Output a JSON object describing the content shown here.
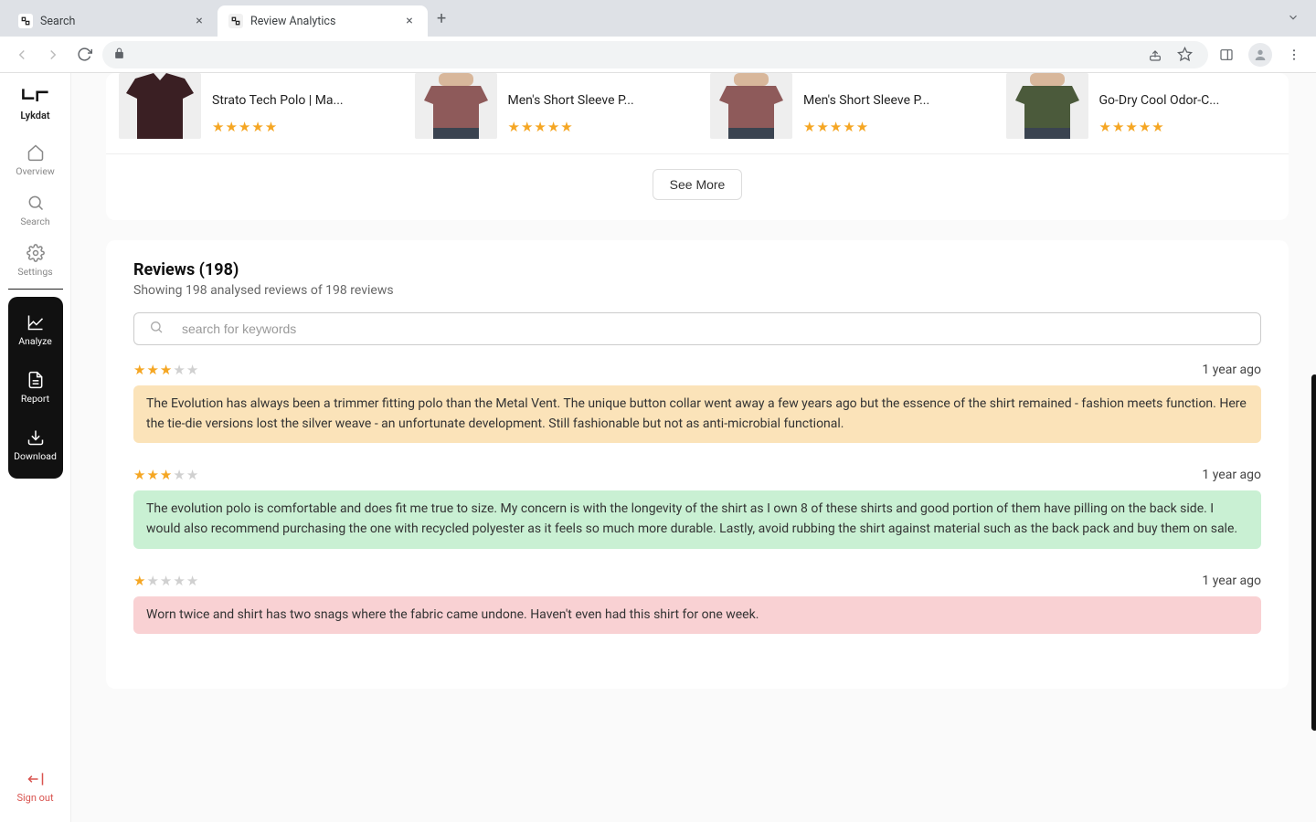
{
  "browser": {
    "tabs": [
      {
        "title": "Search",
        "active": false
      },
      {
        "title": "Review Analytics",
        "active": true
      }
    ]
  },
  "brand": {
    "name": "Lykdat"
  },
  "sidebar": {
    "items": [
      {
        "key": "overview",
        "label": "Overview"
      },
      {
        "key": "search",
        "label": "Search"
      },
      {
        "key": "settings",
        "label": "Settings"
      }
    ],
    "dark_items": [
      {
        "key": "analyze",
        "label": "Analyze"
      },
      {
        "key": "report",
        "label": "Report"
      },
      {
        "key": "download",
        "label": "Download"
      }
    ],
    "signout_label": "Sign out"
  },
  "products": {
    "items": [
      {
        "title": "Strato Tech Polo | Ma...",
        "rating": 5,
        "color": "#3a1f23"
      },
      {
        "title": "Men's Short Sleeve P...",
        "rating": 5,
        "color": "#8e5a5a"
      },
      {
        "title": "Men's Short Sleeve P...",
        "rating": 5,
        "color": "#8e5a5a"
      },
      {
        "title": "Go-Dry Cool Odor-C...",
        "rating": 5,
        "color": "#4b5a3b"
      }
    ],
    "see_more_label": "See More"
  },
  "reviews": {
    "heading": "Reviews (198)",
    "subheading": "Showing 198 analysed reviews of 198 reviews",
    "search_placeholder": "search for keywords",
    "items": [
      {
        "rating": 3,
        "date": "1 year ago",
        "sentiment": "neutral",
        "text": "The Evolution has always been a trimmer fitting polo than the Metal Vent. The unique button collar went away a few years ago but the essence of the shirt remained - fashion meets function. Here the tie-die versions lost the silver weave - an unfortunate development. Still fashionable but not as anti-microbial functional."
      },
      {
        "rating": 3,
        "date": "1 year ago",
        "sentiment": "positive",
        "text": "The evolution polo is comfortable and does fit me true to size. My concern is with the longevity of the shirt as I own 8 of these shirts and good portion of them have pilling on the back side. I would also recommend purchasing the one with recycled polyester as it feels so much more durable. Lastly, avoid rubbing the shirt against material such as the back pack and buy them on sale."
      },
      {
        "rating": 1,
        "date": "1 year ago",
        "sentiment": "negative",
        "text": "Worn twice and shirt has two snags where the fabric came undone. Haven't even had this shirt for one week."
      }
    ]
  }
}
